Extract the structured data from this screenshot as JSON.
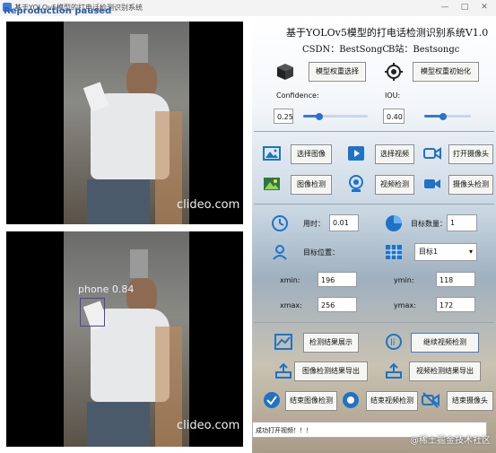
{
  "window": {
    "title": "基于YOLOv5模型的打电话检测识别系统",
    "overlay_text": "Reproduction paused",
    "controls": [
      "—",
      "□",
      "✕"
    ]
  },
  "videos": {
    "top": {
      "watermark": "clideo.com"
    },
    "bottom": {
      "watermark": "clideo.com",
      "detection_label": "phone 0.84"
    }
  },
  "header": {
    "title": "基于YOLOv5模型的打电话检测识别系统V1.0",
    "csdn": "CSDN：BestSongC",
    "bilibili": "B站：Bestsongc"
  },
  "model": {
    "select_label": "模型权重选择",
    "init_label": "模型权重初始化"
  },
  "params": {
    "confidence_label": "Confidence:",
    "confidence_value": "0.25",
    "confidence_level": 0.25,
    "iou_label": "IOU:",
    "iou_value": "0.40",
    "iou_level": 0.4
  },
  "buttons": {
    "select_image": "选择图像",
    "select_video": "选择视频",
    "open_camera": "打开摄像头",
    "image_detect": "图像检测",
    "video_detect": "视频检测",
    "camera_detect": "摄像头检测",
    "show_result": "检测结果展示",
    "continue_video": "继续视频检测",
    "export_image": "图像检测结果导出",
    "export_video": "视频检测结果导出",
    "stop_image": "结束图像检测",
    "stop_video": "结束视频检测",
    "stop_camera": "结束摄像头"
  },
  "info": {
    "time_label": "用时：",
    "time_value": "0.01",
    "count_label": "目标数量：",
    "count_value": "1",
    "position_label": "目标位置：",
    "target_select": "目标1",
    "xmin_label": "xmin:",
    "xmin_value": "196",
    "ymin_label": "ymin:",
    "ymin_value": "118",
    "xmax_label": "xmax:",
    "xmax_value": "256",
    "ymax_label": "ymax:",
    "ymax_value": "172"
  },
  "status": {
    "text": "成功打开视频！！！"
  },
  "corner_watermark": "@稀土掘金技术社区",
  "colors": {
    "accent": "#2f6fd0",
    "detection_box": "#4a3fb4"
  }
}
